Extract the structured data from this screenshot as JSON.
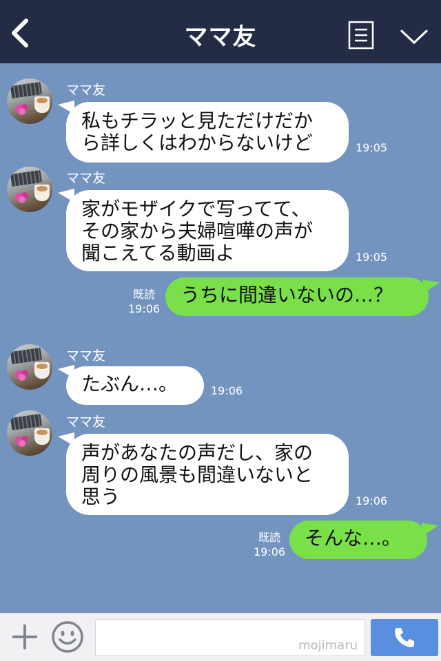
{
  "header": {
    "title": "ママ友",
    "back_icon": "chevron-left-icon",
    "menu_icon": "document-menu-icon",
    "more_icon": "chevron-down-icon"
  },
  "messages": [
    {
      "sender": "ママ友",
      "side": "left",
      "text": "私もチラッと見ただけだか\nら詳しくはわからないけど",
      "time": "19:05"
    },
    {
      "sender": "ママ友",
      "side": "left",
      "text": "家がモザイクで写ってて、\nその家から夫婦喧嘩の声が\n聞こえてる動画よ",
      "time": "19:05"
    },
    {
      "side": "right",
      "text": "うちに間違いないの…？",
      "read": "既読",
      "time": "19:06"
    },
    {
      "sender": "ママ友",
      "side": "left",
      "text": "たぶん…。",
      "time": "19:06"
    },
    {
      "sender": "ママ友",
      "side": "left",
      "text": "声があなたの声だし、家の\n周りの風景も間違いないと\n思う",
      "time": "19:06"
    },
    {
      "side": "right",
      "text": "そんな…。",
      "read": "既読",
      "time": "19:06"
    }
  ],
  "input_bar": {
    "watermark": "mojimaru",
    "plus_icon": "plus-icon",
    "emoji_icon": "smiley-icon",
    "call_icon": "phone-icon"
  },
  "colors": {
    "header_bg": "#232c44",
    "chat_bg": "#7494c0",
    "my_bubble": "#79e04a",
    "their_bubble": "#ffffff",
    "call_button": "#5a8fe0"
  }
}
